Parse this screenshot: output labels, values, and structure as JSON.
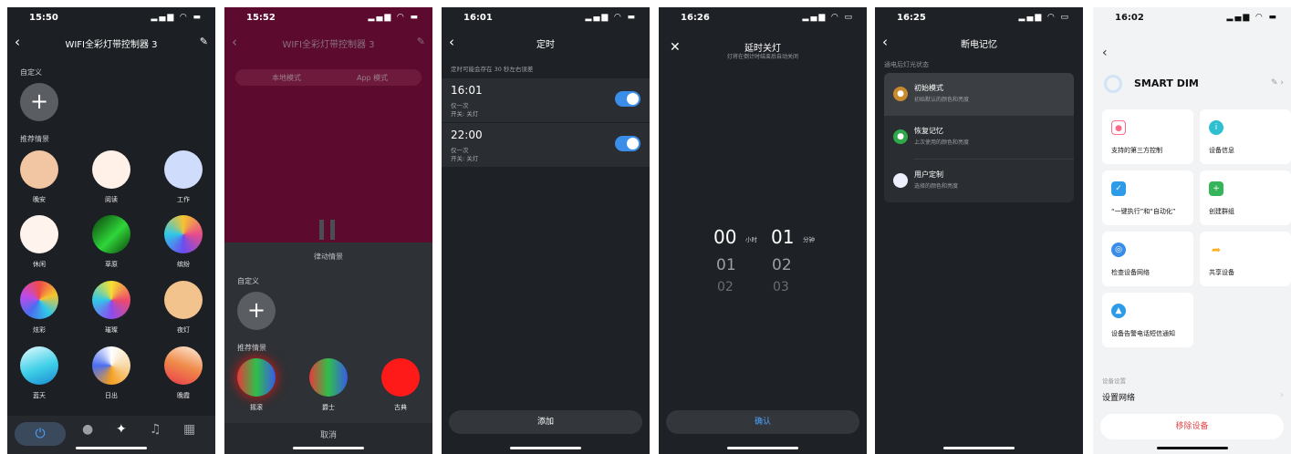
{
  "screen1": {
    "time": "15:50",
    "status_icons": "∵ ▮",
    "title": "WIFI全彩灯带控制器 3",
    "custom_label": "自定义",
    "add_symbol": "+",
    "recommended_label": "推荐情景",
    "scenes": [
      {
        "label": "晚安",
        "color": "#f3c6a3"
      },
      {
        "label": "阅读",
        "color": "#fff1e8"
      },
      {
        "label": "工作",
        "color": "#cfdcfb"
      },
      {
        "label": "休闲",
        "color": "#fff3ee"
      },
      {
        "label": "草原",
        "color": "#1a8a2a"
      },
      {
        "label": "缤纷",
        "color": "#e84c8a"
      },
      {
        "label": "炫彩",
        "color": "#4a6df0"
      },
      {
        "label": "璀璨",
        "color": "#f5a020"
      },
      {
        "label": "夜灯",
        "color": "#f2c38c"
      },
      {
        "label": "蓝天",
        "color": "#3fd0e8"
      },
      {
        "label": "日出",
        "color": "#f7d9a8"
      },
      {
        "label": "晚霞",
        "color": "#f08a4a"
      }
    ],
    "tabs": [
      "⏻",
      "●",
      "✦",
      "♫",
      "▦"
    ]
  },
  "screen2": {
    "time": "15:52",
    "title": "WIFI全彩灯带控制器 3",
    "mode_local": "本地模式",
    "mode_app": "App 模式",
    "sheet_title": "律动情景",
    "custom_label": "自定义",
    "add_symbol": "+",
    "recommended_label": "推荐情景",
    "scenes": [
      {
        "label": "摇滚",
        "color": "#2fbf4a"
      },
      {
        "label": "爵士",
        "color": "#2fbf4a"
      },
      {
        "label": "古典",
        "color": "#ff1a1a"
      }
    ],
    "cancel": "取消"
  },
  "screen3": {
    "time": "16:01",
    "title": "定时",
    "note": "定时可能会存在 30 秒左右误差",
    "timers": [
      {
        "time": "16:01",
        "repeat": "仅一次",
        "switch": "开关: 关灯",
        "on": true
      },
      {
        "time": "22:00",
        "repeat": "仅一次",
        "switch": "开关: 关灯",
        "on": true
      }
    ],
    "add": "添加"
  },
  "screen4": {
    "time": "16:26",
    "title": "延时关灯",
    "subtitle": "灯将在倒计时结束后自动关闭",
    "hours": [
      "00",
      "01",
      "02"
    ],
    "minutes": [
      "01",
      "02",
      "03"
    ],
    "hour_unit": "小时",
    "minute_unit": "分钟",
    "confirm": "确认"
  },
  "screen5": {
    "time": "16:25",
    "title": "断电记忆",
    "section": "通电后灯光状态",
    "options": [
      {
        "name": "初始模式",
        "desc": "初始默认的颜色和亮度",
        "color": "#c98a2e"
      },
      {
        "name": "恢复记忆",
        "desc": "上次使用的颜色和亮度",
        "color": "#2fa84a"
      },
      {
        "name": "用户定制",
        "desc": "选择的颜色和亮度",
        "color": "#eef0ff"
      }
    ]
  },
  "screen6": {
    "time": "16:02",
    "device_name": "SMART DIM",
    "cards": [
      {
        "label": "支持的第三方控制",
        "color": "#ff6b8a",
        "glyph": "●"
      },
      {
        "label": "设备信息",
        "color": "#2ec0d0",
        "glyph": "i"
      },
      {
        "label": "“一键执行”和“自动化”",
        "color": "#2e9be8",
        "glyph": "✓"
      },
      {
        "label": "创建群组",
        "color": "#36b45a",
        "glyph": "+"
      },
      {
        "label": "检查设备网络",
        "color": "#3a8ee8",
        "glyph": "◎"
      },
      {
        "label": "共享设备",
        "color": "#ffb020",
        "glyph": "➦"
      },
      {
        "label": "设备告警电话短信通知",
        "color": "#2e9be8",
        "glyph": "▲"
      }
    ],
    "settings_label": "设备设置",
    "network_row": "设置网络",
    "remove": "移除设备"
  }
}
